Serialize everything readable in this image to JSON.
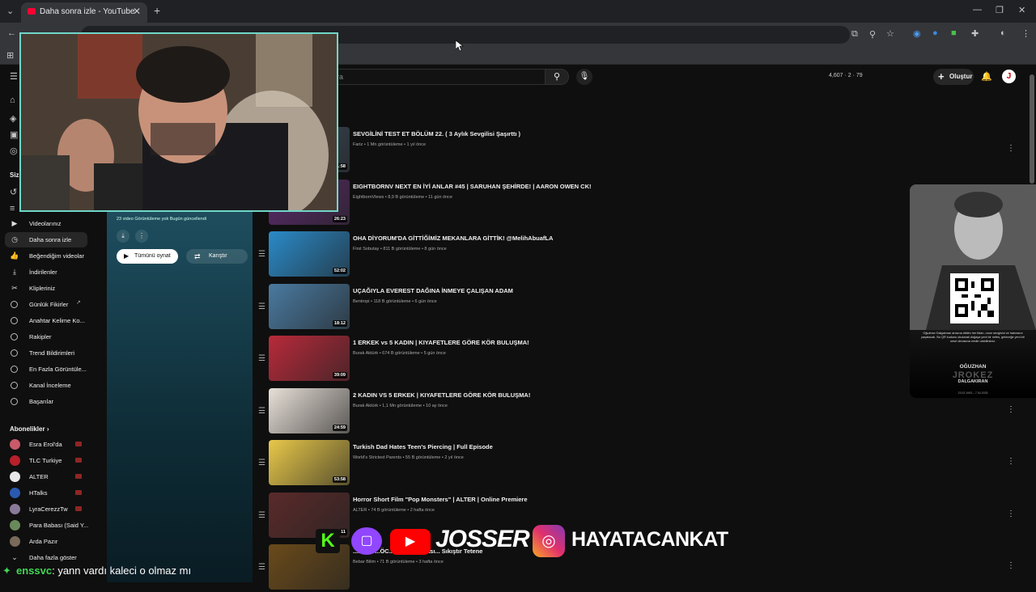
{
  "browser": {
    "tab_title": "Daha sonra izle - YouTube",
    "new_tab": "+",
    "close_tab": "✕"
  },
  "youtube": {
    "search_placeholder": "ra",
    "stats": "4,607 · 2 · 79",
    "create_label": "Oluştur",
    "avatar_letter": "J"
  },
  "sidebar": {
    "section_you": "Siz",
    "items": [
      {
        "label": "Videolarınız",
        "icon": "video-icon"
      },
      {
        "label": "Daha sonra izle",
        "icon": "clock-icon",
        "active": true
      },
      {
        "label": "Beğendiğim videolar",
        "icon": "like-icon"
      },
      {
        "label": "İndirilenler",
        "icon": "download-icon"
      },
      {
        "label": "Klipleriniz",
        "icon": "scissors-icon"
      },
      {
        "label": "Günlük Fikirler",
        "icon": "external-link-icon"
      },
      {
        "label": "Anahtar Kelime Ko...",
        "icon": "circle-icon"
      },
      {
        "label": "Rakipler",
        "icon": "circle-icon"
      },
      {
        "label": "Trend Bildirimleri",
        "icon": "circle-icon"
      },
      {
        "label": "En Fazla Görüntüle...",
        "icon": "circle-icon"
      },
      {
        "label": "Kanal İnceleme",
        "icon": "circle-icon"
      },
      {
        "label": "Başarılar",
        "icon": "circle-icon"
      }
    ],
    "subs_heading": "Abonelikler",
    "subscriptions": [
      {
        "label": "Esra Erol'da",
        "color": "#c85a6a"
      },
      {
        "label": "TLC Turkiye",
        "color": "#b8202a"
      },
      {
        "label": "ALTER",
        "color": "#e8e8e8"
      },
      {
        "label": "HTalks",
        "color": "#2a5ab0"
      },
      {
        "label": "LyraCerezzTw",
        "color": "#8a7a9a"
      },
      {
        "label": "Para Babası (Said Y...",
        "color": "#6a8a5a"
      },
      {
        "label": "Arda Pazır",
        "color": "#7a6a5a"
      }
    ],
    "show_more": "Daha fazla göster"
  },
  "playlist": {
    "meta": "23 video  Görüntüleme yok  Bugün güncellendi",
    "play_all": "Tümünü oynat",
    "shuffle": "Karıştır"
  },
  "videos": [
    {
      "title": "SEVGİLİNİ TEST ET BÖLÜM 22. ( 3 Aylık Sevgilisi Şaşırttı )",
      "meta": "Fariz • 1 Mn görüntüleme • 1 yıl önce",
      "duration": "1:58",
      "color": "#3a4a5a"
    },
    {
      "title": "EIGHTBORNV NEXT EN İYİ ANLAR #45 | SARUHAN ŞEHİRDE! | AARON OWEN CK!",
      "meta": "EightbornVlews • 8,9 B görüntüleme • 11 gün önce",
      "duration": "26:23",
      "color": "#5a2a6a"
    },
    {
      "title": "OHA DİYORUM'DA GİTTİĞİMİZ MEKANLARA GİTTİK! @MelihAbuafLA",
      "meta": "First Sobutay • 811 B görüntüleme • 8 gün önce",
      "duration": "52:02",
      "color": "#2a8ac8"
    },
    {
      "title": "UÇAĞIYLA EVEREST DAĞINA İNMEYE ÇALIŞAN ADAM",
      "meta": "Bentropi • 118 B görüntüleme • 6 gün önce",
      "duration": "18:12",
      "color": "#4a7aa0"
    },
    {
      "title": "1 ERKEK vs 5 KADIN | KIYAFETLERE GÖRE KÖR BULUŞMA!",
      "meta": "Burak Aktürk • 674 B görüntüleme • 5 gün önce",
      "duration": "39:09",
      "color": "#b82a3a"
    },
    {
      "title": "2 KADIN VS 5 ERKEK | KIYAFETLERE GÖRE KÖR BULUŞMA!",
      "meta": "Burak Aktürk • 1,1 Mn görüntüleme • 10 ay önce",
      "duration": "24:59",
      "color": "#e8e0d8"
    },
    {
      "title": "Turkish Dad Hates Teen's Piercing | Full Episode",
      "meta": "World's Strictest Parents • 55 B görüntüleme • 2 yıl önce",
      "duration": "53:58",
      "color": "#e8c84a"
    },
    {
      "title": "Horror Short Film \"Pop Monsters\" | ALTER | Online Premiere",
      "meta": "ALTER • 74 B görüntüleme • 2 hafta önce",
      "duration": "11",
      "color": "#5a2a2a"
    },
    {
      "title": "...K A... ...ÖC... Çıtık Mandası... Sıkıştır Tetene",
      "meta": "Bebar Bilim • 71 B görüntüleme • 3 hafta önce",
      "duration": "",
      "color": "#6a4a1a"
    }
  ],
  "memorial": {
    "text": "Oğuzhan Dalgakıran anısına diktim her fidan, onun sevgisini ve hatırasını yaşatacak. Bu QR kodunu okutarak doğaya yeni bir nefes, geleceğe yeni bir umut olmasına vesile olabilirsiniz.",
    "name_top": "OĞUZHAN",
    "name_mid": "JROKEZ",
    "name_bottom": "DALGAKIRAN",
    "dates": "23.02.1993 – 7.04.2025"
  },
  "overlay": {
    "handle_youtube": "JOSSER",
    "handle_instagram": "HAYATACANKAT",
    "chat_user": "enssvc",
    "chat_message": ": yann vardı kaleci o olmaz mı"
  }
}
